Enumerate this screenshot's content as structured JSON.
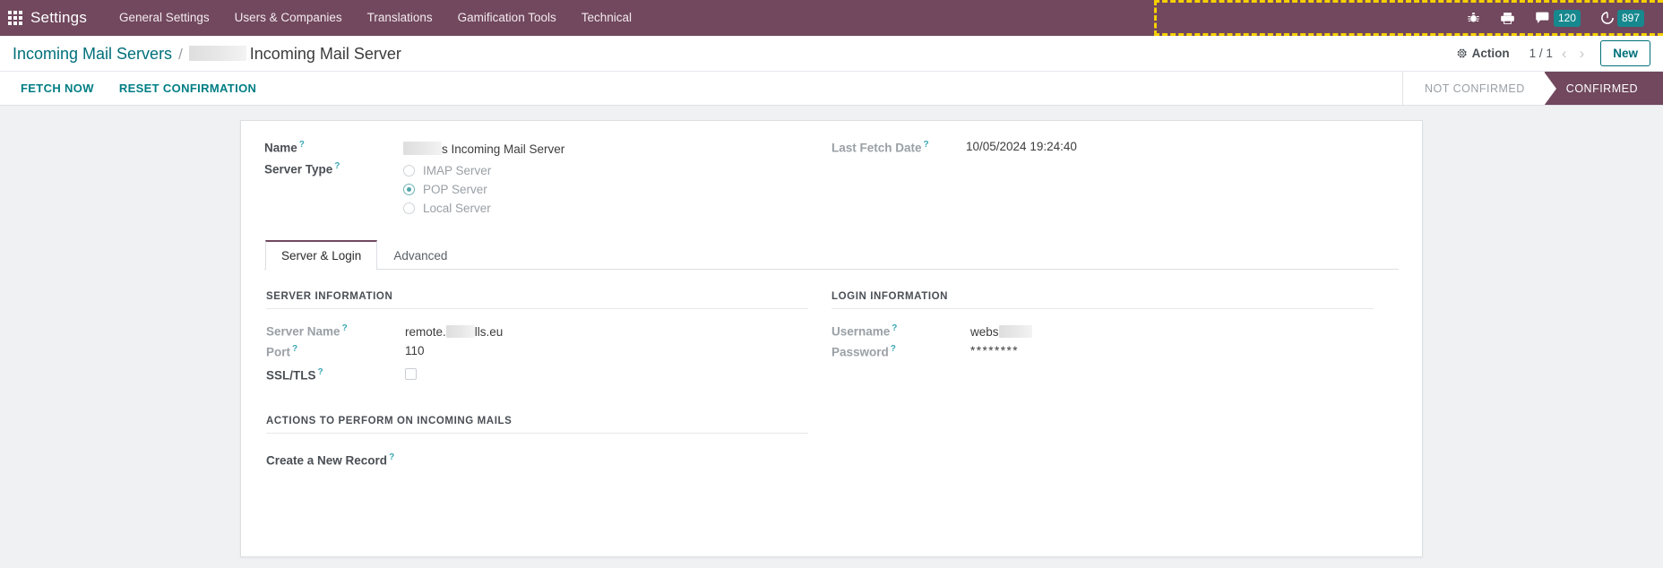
{
  "colors": {
    "navbar_bg": "#71485e",
    "accent_teal": "#00707a",
    "badge_teal": "#17888e",
    "highlight_yellow": "#f5d000",
    "sheet_bg": "#ffffff",
    "page_bg": "#f0f1f3"
  },
  "navbar": {
    "apps_icon": "apps-grid-icon",
    "brand": "Settings",
    "menus": [
      {
        "label": "General Settings"
      },
      {
        "label": "Users & Companies"
      },
      {
        "label": "Translations"
      },
      {
        "label": "Gamification Tools"
      },
      {
        "label": "Technical"
      }
    ],
    "systray": [
      {
        "icon": "bug-icon",
        "name": "debug-menu",
        "badge": ""
      },
      {
        "icon": "printer-icon",
        "name": "print-menu",
        "badge": ""
      },
      {
        "icon": "chat-bubble-icon",
        "name": "messaging-menu",
        "badge": "120"
      },
      {
        "icon": "clock-activity-icon",
        "name": "activity-menu",
        "badge": "897"
      }
    ]
  },
  "breadcrumb": {
    "parent": "Incoming Mail Servers",
    "separator": "/",
    "current_redacted": true,
    "current": "Incoming Mail Server"
  },
  "controlpanel": {
    "action_icon": "gear-icon",
    "action_label": "Action",
    "pager": "1 / 1",
    "prev_icon": "chevron-left-icon",
    "next_icon": "chevron-right-icon",
    "new_label": "New"
  },
  "statusbuttons": [
    {
      "label": "FETCH NOW",
      "name": "fetch-now-button"
    },
    {
      "label": "RESET CONFIRMATION",
      "name": "reset-confirmation-button"
    }
  ],
  "statusbar": {
    "stages": [
      {
        "label": "NOT CONFIRMED",
        "active": false
      },
      {
        "label": "CONFIRMED",
        "active": true
      }
    ]
  },
  "form": {
    "left": {
      "name": {
        "label": "Name",
        "value": "s Incoming Mail Server",
        "redacted": true
      },
      "server_type": {
        "label": "Server Type",
        "options": [
          {
            "label": "IMAP Server",
            "selected": false
          },
          {
            "label": "POP Server",
            "selected": true
          },
          {
            "label": "Local Server",
            "selected": false
          }
        ]
      }
    },
    "right": {
      "last_fetch_date": {
        "label": "Last Fetch Date",
        "value": "10/05/2024 19:24:40"
      }
    }
  },
  "notebook": {
    "tabs": [
      {
        "label": "Server & Login",
        "active": true
      },
      {
        "label": "Advanced",
        "active": false
      }
    ],
    "server_information": {
      "title": "SERVER INFORMATION",
      "server_name": {
        "label": "Server Name",
        "value_prefix": "remote.",
        "value_suffix": "lls.eu",
        "redacted": true
      },
      "port": {
        "label": "Port",
        "value": "110"
      },
      "ssl_tls": {
        "label": "SSL/TLS",
        "checked": false
      }
    },
    "login_information": {
      "title": "LOGIN INFORMATION",
      "username": {
        "label": "Username",
        "value_prefix": "webs",
        "redacted": true
      },
      "password": {
        "label": "Password",
        "value": "********"
      }
    },
    "actions_section": {
      "title": "ACTIONS TO PERFORM ON INCOMING MAILS",
      "create_new_record": {
        "label": "Create a New Record"
      }
    }
  }
}
